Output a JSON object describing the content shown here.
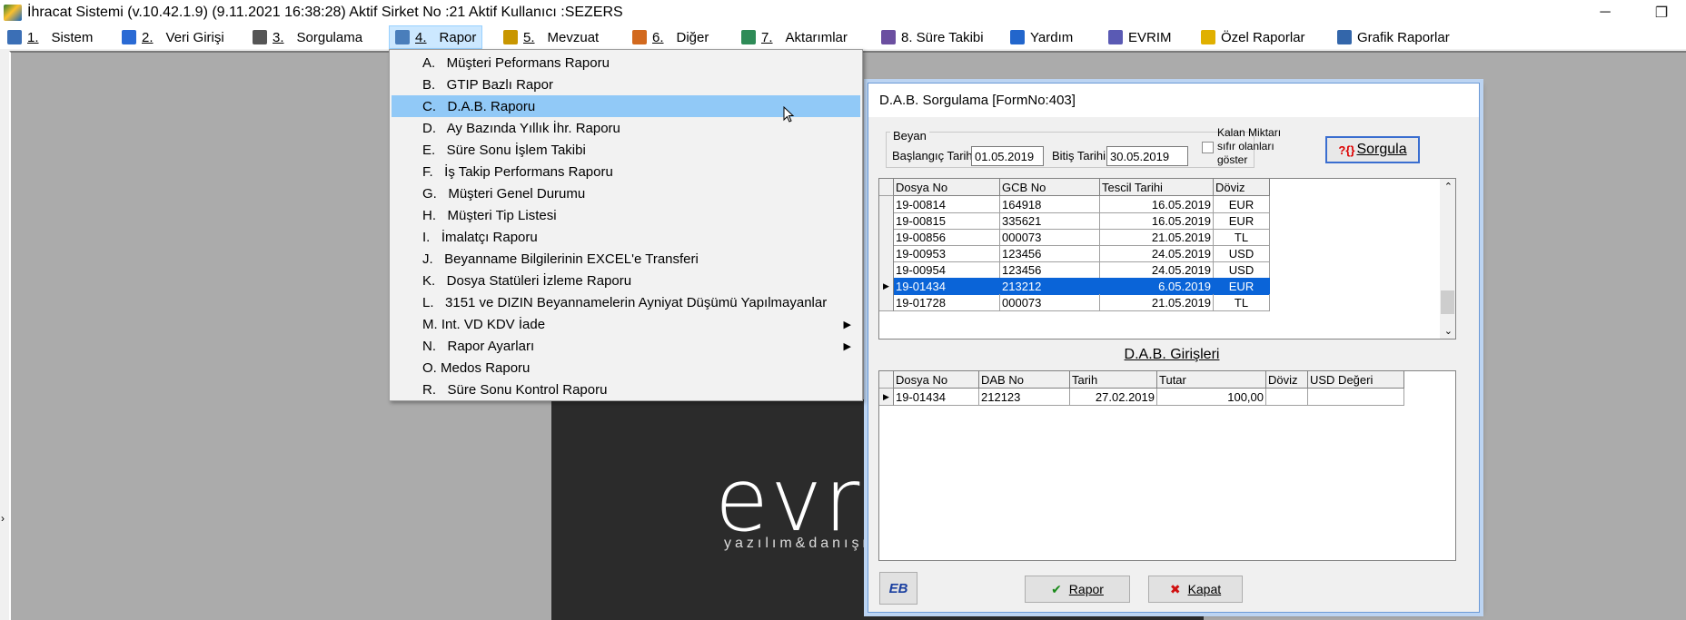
{
  "window": {
    "title": "İhracat Sistemi (v.10.42.1.9) (9.11.2021 16:38:28) Aktif Sirket No :21 Aktif Kullanıcı :SEZERS",
    "minimize": "─",
    "restore": "❐"
  },
  "menubar": [
    {
      "num": "1.",
      "label": "Sistem",
      "icon_color": "#3b6fb6"
    },
    {
      "num": "2.",
      "label": "Veri Girişi",
      "icon_color": "#2a6ad4"
    },
    {
      "num": "3.",
      "label": "Sorgulama",
      "icon_color": "#555555"
    },
    {
      "num": "4.",
      "label": "Rapor",
      "icon_color": "#4a7ebb"
    },
    {
      "num": "5.",
      "label": "Mevzuat",
      "icon_color": "#c89600"
    },
    {
      "num": "6.",
      "label": "Diğer",
      "icon_color": "#d2691e"
    },
    {
      "num": "7.",
      "label": "Aktarımlar",
      "icon_color": "#2e8b57"
    },
    {
      "num": "",
      "label": "8. Süre Takibi",
      "icon_color": "#6b4fa0"
    },
    {
      "num": "",
      "label": "Yardım",
      "icon_color": "#2266cc"
    },
    {
      "num": "",
      "label": "EVRIM",
      "icon_color": "#5a5ab4"
    },
    {
      "num": "",
      "label": "Özel Raporlar",
      "icon_color": "#e0b000"
    },
    {
      "num": "",
      "label": "Grafik Raporlar",
      "icon_color": "#3366aa"
    }
  ],
  "rapor_menu": [
    {
      "label": "A.   Müşteri Peformans Raporu",
      "submenu": false
    },
    {
      "label": "B.   GTIP Bazlı Rapor",
      "submenu": false
    },
    {
      "label": "C.   D.A.B. Raporu",
      "submenu": false
    },
    {
      "label": "D.   Ay Bazında Yıllık İhr. Raporu",
      "submenu": false
    },
    {
      "label": "E.   Süre Sonu İşlem Takibi",
      "submenu": false
    },
    {
      "label": "F.   İş Takip Performans Raporu",
      "submenu": false
    },
    {
      "label": "G.   Müşteri Genel Durumu",
      "submenu": false
    },
    {
      "label": "H.   Müşteri Tip Listesi",
      "submenu": false
    },
    {
      "label": "I.   İmalatçı Raporu",
      "submenu": false
    },
    {
      "label": "J.   Beyanname Bilgilerinin EXCEL'e Transferi",
      "submenu": false
    },
    {
      "label": "K.   Dosya Statüleri İzleme Raporu",
      "submenu": false
    },
    {
      "label": "L.   3151 ve DIZIN Beyannamelerin Ayniyat Düşümü Yapılmayanlar",
      "submenu": false
    },
    {
      "label": "M. Int. VD KDV İade",
      "submenu": true
    },
    {
      "label": "N.   Rapor Ayarları",
      "submenu": true
    },
    {
      "label": "O. Medos Raporu",
      "submenu": false
    },
    {
      "label": "R.   Süre Sonu Kontrol Raporu",
      "submenu": false
    }
  ],
  "rapor_menu_highlight": 2,
  "submenu_arrow": "▶",
  "background_logo": {
    "text": "evr",
    "sub": "yazılım&danışma"
  },
  "dialog": {
    "title": "D.A.B. Sorgulama [FormNo:403]",
    "beyan_label": "Beyan",
    "start_label": "Başlangıç Tarihi",
    "start_value": "01.05.2019",
    "end_label": "Bitiş Tarihi",
    "end_value": "30.05.2019",
    "kalan_label_1": "Kalan Miktarı",
    "kalan_label_2": "sıfır olanları",
    "kalan_label_3": "göster",
    "sorgula_icon": "?{}",
    "sorgula_label": "Sorgula",
    "grid1": {
      "columns": [
        "Dosya No",
        "GCB No",
        "Tescil Tarihi",
        "Döviz"
      ],
      "rows": [
        {
          "dosya": "19-00814",
          "gcb": "164918",
          "tarih": "16.05.2019",
          "doviz": "EUR"
        },
        {
          "dosya": "19-00815",
          "gcb": "335621",
          "tarih": "16.05.2019",
          "doviz": "EUR"
        },
        {
          "dosya": "19-00856",
          "gcb": "000073",
          "tarih": "21.05.2019",
          "doviz": "TL"
        },
        {
          "dosya": "19-00953",
          "gcb": "123456",
          "tarih": "24.05.2019",
          "doviz": "USD"
        },
        {
          "dosya": "19-00954",
          "gcb": "123456",
          "tarih": "24.05.2019",
          "doviz": "USD"
        },
        {
          "dosya": "19-01434",
          "gcb": "213212",
          "tarih": "6.05.2019",
          "doviz": "EUR"
        },
        {
          "dosya": "19-01728",
          "gcb": "000073",
          "tarih": "21.05.2019",
          "doviz": "TL"
        }
      ],
      "selected_row": 5
    },
    "girisleri_title": "D.A.B. Girişleri",
    "grid2": {
      "columns": [
        "Dosya No",
        "DAB No",
        "Tarih",
        "Tutar",
        "Döviz",
        "USD Değeri"
      ],
      "rows": [
        {
          "dosya": "19-01434",
          "dab": "212123",
          "tarih": "27.02.2019",
          "tutar": "100,00",
          "doviz": "",
          "usd": ""
        }
      ]
    },
    "eb_label": "EB",
    "rapor_label": "Rapor",
    "kapat_label": "Kapat"
  }
}
